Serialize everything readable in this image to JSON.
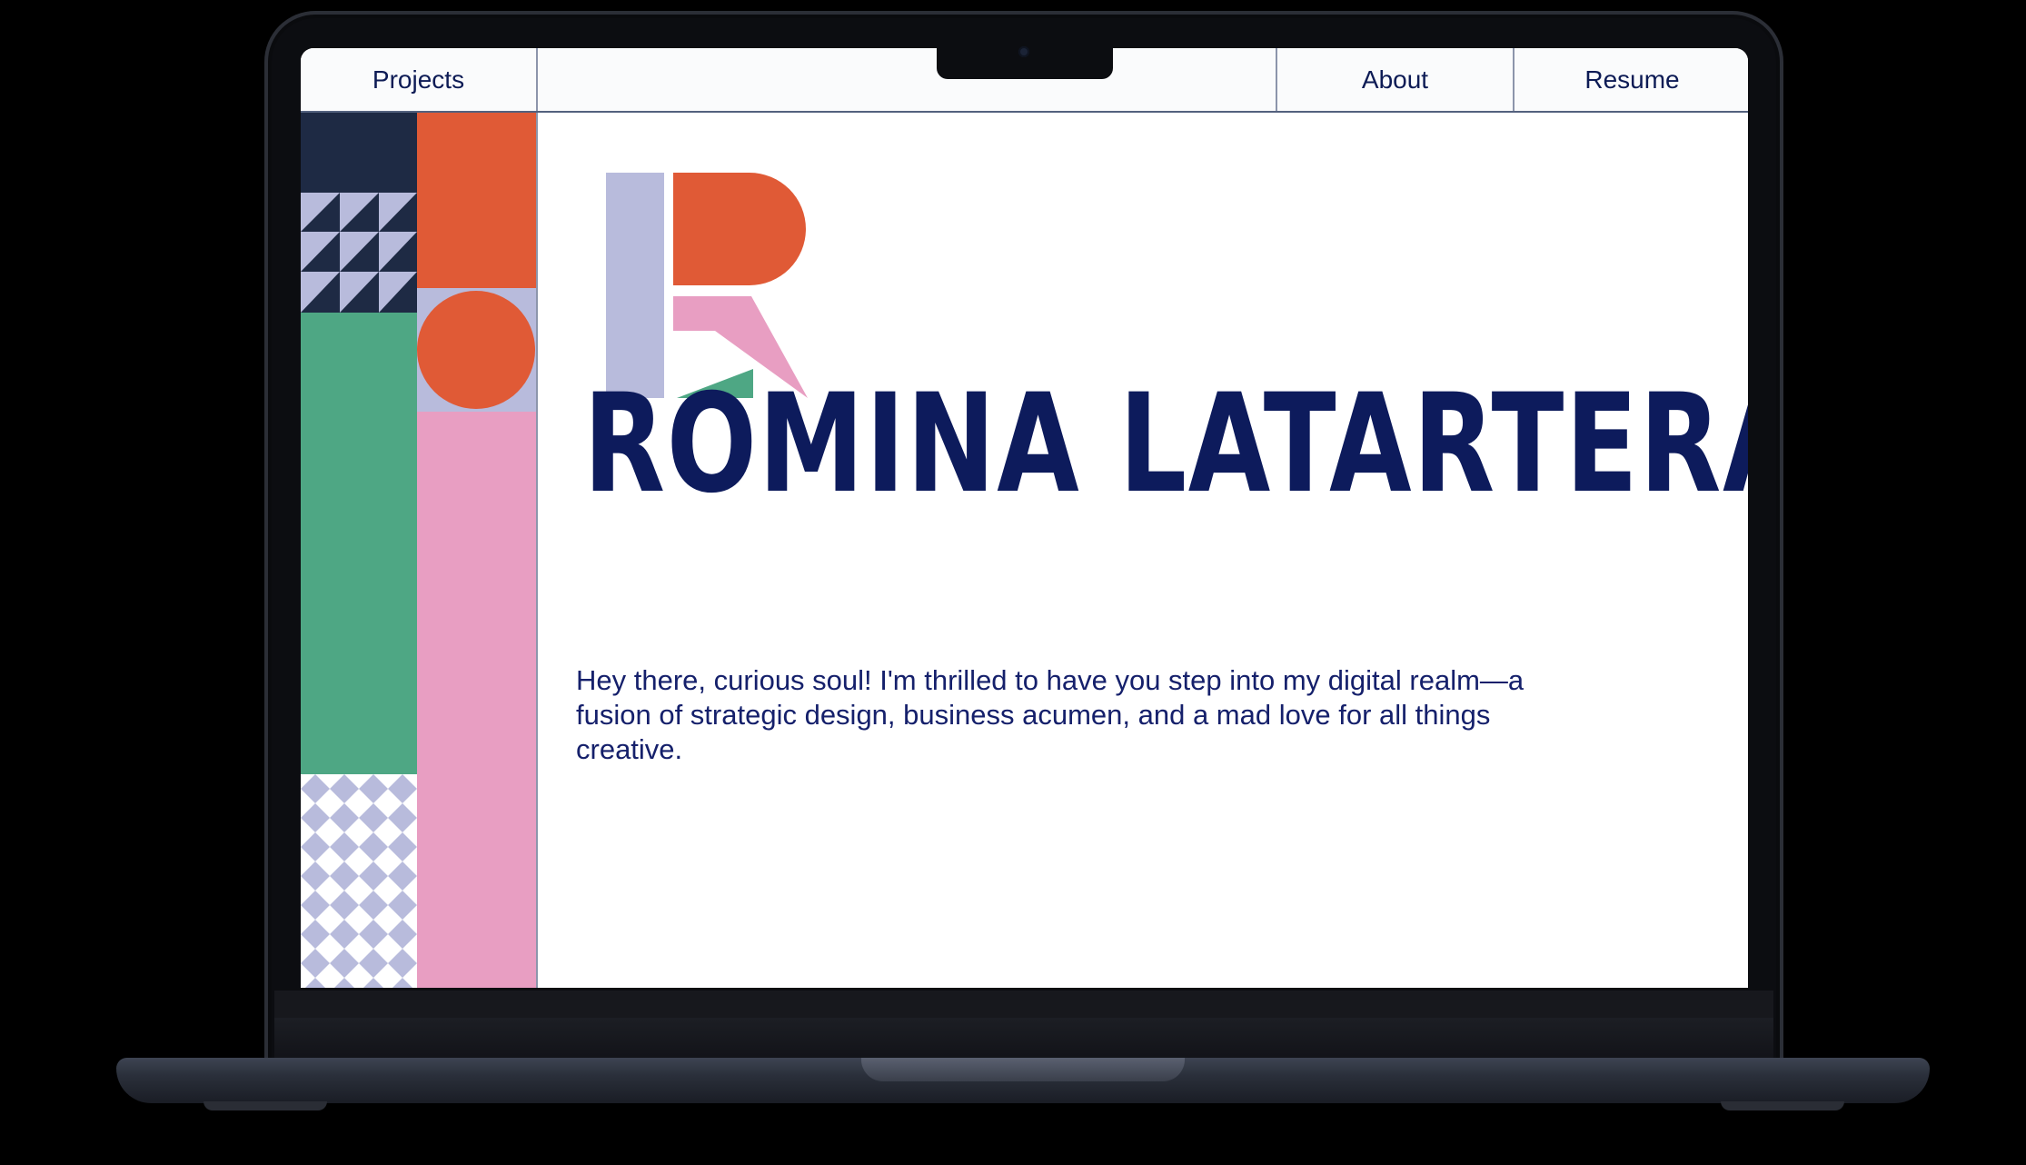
{
  "nav": {
    "projects_label": "Projects",
    "about_label": "About",
    "resume_label": "Resume"
  },
  "hero": {
    "name": "ROMINA LATARTERA",
    "intro": "Hey there, curious soul! I'm thrilled to have you step into my digital realm—a fusion of strategic design, business acumen, and a mad love for all things creative."
  },
  "colors": {
    "navy": "#1e2a44",
    "orange": "#e05a36",
    "lavender": "#b8bbdc",
    "green": "#4ea784",
    "pink": "#e89ec2",
    "text": "#0d1b5c"
  },
  "icons": {
    "logo": "monogram-r-logo"
  }
}
